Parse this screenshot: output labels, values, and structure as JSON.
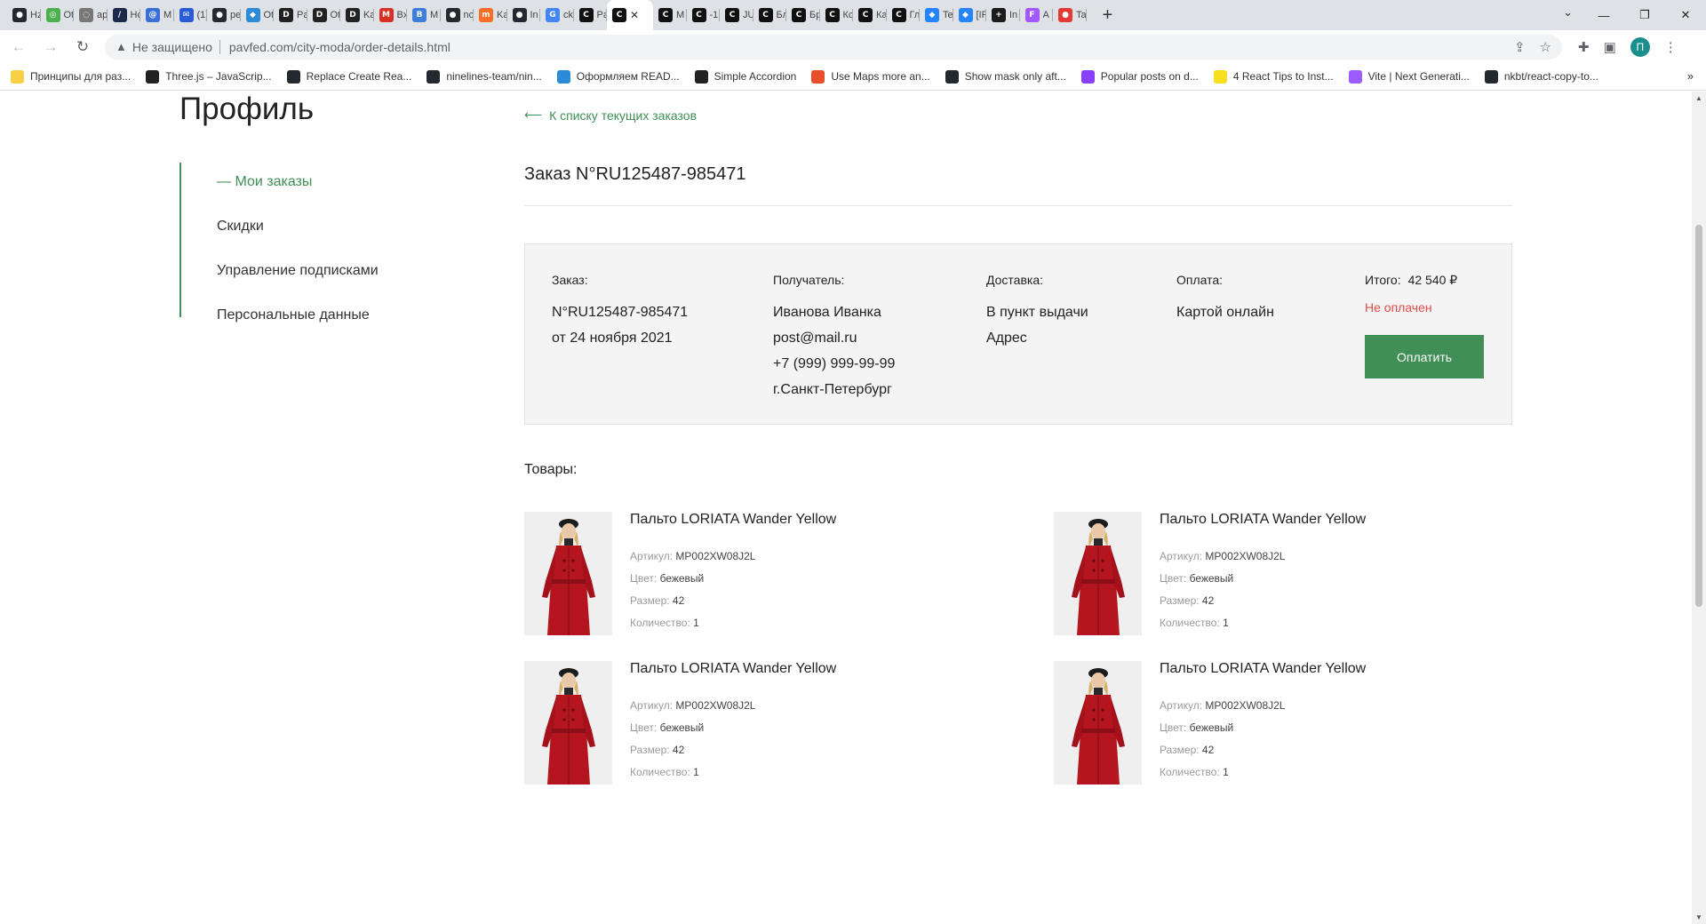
{
  "browser": {
    "tabs": [
      {
        "icon": "github-icon",
        "title": "Hz",
        "color": "#24292f",
        "glyph": "●"
      },
      {
        "icon": "circle-icon",
        "title": "Ot",
        "color": "#4caf50",
        "glyph": "◎"
      },
      {
        "icon": "globe-icon",
        "title": "ap",
        "color": "#777777",
        "glyph": "◌"
      },
      {
        "icon": "slash-icon",
        "title": "Hc",
        "color": "#1b2a4a",
        "glyph": "/"
      },
      {
        "icon": "at-icon",
        "title": "M",
        "color": "#3b6fd8",
        "glyph": "@"
      },
      {
        "icon": "mail-icon",
        "title": "(1)",
        "color": "#2a5bd7",
        "glyph": "✉"
      },
      {
        "icon": "github-icon",
        "title": "pe",
        "color": "#24292f",
        "glyph": "●"
      },
      {
        "icon": "puzzle-icon",
        "title": "Ot",
        "color": "#2b8bd6",
        "glyph": "◆"
      },
      {
        "icon": "deu-icon",
        "title": "Pa",
        "color": "#222222",
        "glyph": "D"
      },
      {
        "icon": "deu-icon",
        "title": "Ot",
        "color": "#222222",
        "glyph": "D"
      },
      {
        "icon": "deu-icon",
        "title": "Ka",
        "color": "#222222",
        "glyph": "D"
      },
      {
        "icon": "gmail-icon",
        "title": "Bx",
        "color": "#d93025",
        "glyph": "M"
      },
      {
        "icon": "box-icon",
        "title": "M",
        "color": "#3f7fd8",
        "glyph": "B"
      },
      {
        "icon": "github-icon",
        "title": "nc",
        "color": "#24292f",
        "glyph": "●"
      },
      {
        "icon": "gitlab-icon",
        "title": "Ka",
        "color": "#fc6d26",
        "glyph": "m"
      },
      {
        "icon": "github-icon",
        "title": "In",
        "color": "#24292f",
        "glyph": "●"
      },
      {
        "icon": "google-icon",
        "title": "ck",
        "color": "#4285f4",
        "glyph": "G"
      },
      {
        "icon": "codepen-icon",
        "title": "Pa",
        "color": "#111111",
        "glyph": "C"
      },
      {
        "icon": "codepen-icon",
        "title": "",
        "color": "#111111",
        "glyph": "C",
        "active": true
      },
      {
        "icon": "codepen-icon",
        "title": "M",
        "color": "#111111",
        "glyph": "C"
      },
      {
        "icon": "codepen-icon",
        "title": "-1",
        "color": "#111111",
        "glyph": "C"
      },
      {
        "icon": "codepen-icon",
        "title": "JU",
        "color": "#111111",
        "glyph": "C"
      },
      {
        "icon": "codepen-icon",
        "title": "Бл",
        "color": "#111111",
        "glyph": "C"
      },
      {
        "icon": "codepen-icon",
        "title": "Бр",
        "color": "#111111",
        "glyph": "C"
      },
      {
        "icon": "codepen-icon",
        "title": "Кс",
        "color": "#111111",
        "glyph": "C"
      },
      {
        "icon": "codepen-icon",
        "title": "Ка",
        "color": "#111111",
        "glyph": "C"
      },
      {
        "icon": "codepen-icon",
        "title": "Гл",
        "color": "#111111",
        "glyph": "C"
      },
      {
        "icon": "jira-icon",
        "title": "Te",
        "color": "#2684ff",
        "glyph": "◆"
      },
      {
        "icon": "jira-icon",
        "title": "[IF",
        "color": "#2684ff",
        "glyph": "◆"
      },
      {
        "icon": "plus-square-icon",
        "title": "In",
        "color": "#1b1b1b",
        "glyph": "+"
      },
      {
        "icon": "figma-icon",
        "title": "A",
        "color": "#a259ff",
        "glyph": "F"
      },
      {
        "icon": "chrome-red-icon",
        "title": "Ta",
        "color": "#e53935",
        "glyph": "●"
      }
    ],
    "active_tab_close": "✕",
    "new_tab": "+",
    "window_controls": {
      "minimize": "—",
      "restore": "❐",
      "close": "✕"
    },
    "tab_search": "⌄",
    "insecure_label": "Не защищено",
    "url": "pavfed.com/city-moda/order-details.html",
    "profile_initial": "П",
    "bookmarks": [
      {
        "icon": "bookmark-icon",
        "label": "Принципы для раз...",
        "color": "#f7d046"
      },
      {
        "icon": "threejs-icon",
        "label": "Three.js – JavaScrip...",
        "color": "#222222"
      },
      {
        "icon": "github-icon",
        "label": "Replace Create Rea...",
        "color": "#24292f"
      },
      {
        "icon": "github-icon",
        "label": "ninelines-team/nin...",
        "color": "#24292f"
      },
      {
        "icon": "puzzle-icon",
        "label": "Оформляем READ...",
        "color": "#2b8bd6"
      },
      {
        "icon": "accordion-icon",
        "label": "Simple Accordion",
        "color": "#222222"
      },
      {
        "icon": "maps-icon",
        "label": "Use Maps more an...",
        "color": "#e94e2a"
      },
      {
        "icon": "github-icon",
        "label": "Show mask only aft...",
        "color": "#24292f"
      },
      {
        "icon": "posts-icon",
        "label": "Popular posts on d...",
        "color": "#8a3ffc"
      },
      {
        "icon": "js-icon",
        "label": "4 React Tips to Inst...",
        "color": "#f7df1e"
      },
      {
        "icon": "vite-icon",
        "label": "Vite | Next Generati...",
        "color": "#9c5cff"
      },
      {
        "icon": "github-icon",
        "label": "nkbt/react-copy-to...",
        "color": "#24292f"
      }
    ],
    "bookmarks_more": "»"
  },
  "page": {
    "title": "Профиль",
    "side_nav": [
      {
        "label": "— Мои заказы",
        "active": true
      },
      {
        "label": "Скидки"
      },
      {
        "label": "Управление подписками"
      },
      {
        "label": "Персональные данные"
      }
    ],
    "back_link": "К списку текущих заказов",
    "order_title": "Заказ N°RU125487-985471",
    "summary": {
      "order": {
        "label": "Заказ:",
        "lines": [
          "N°RU125487-985471",
          "от 24 ноября 2021"
        ]
      },
      "recipient": {
        "label": "Получатель:",
        "lines": [
          "Иванова Иванка",
          "post@mail.ru",
          "+7 (999) 999-99-99",
          "г.Санкт-Петербург"
        ]
      },
      "delivery": {
        "label": "Доставка:",
        "lines": [
          "В пункт выдачи",
          "Адрес"
        ]
      },
      "payment": {
        "label": "Оплата:",
        "lines": [
          "Картой онлайн"
        ]
      },
      "total": {
        "label": "Итого:",
        "value": "42 540 ₽",
        "status": "Не оплачен",
        "status_color": "#e24b4b"
      },
      "pay_button": "Оплатить"
    },
    "goods_label": "Товары:",
    "attr_labels": {
      "sku": "Артикул:",
      "color": "Цвет:",
      "size": "Размер:",
      "qty": "Количество:"
    },
    "products": [
      {
        "name": "Пальто LORIATA Wander Yellow",
        "sku": "MP002XW08J2L",
        "color": "бежевый",
        "size": "42",
        "qty": "1"
      },
      {
        "name": "Пальто LORIATA Wander Yellow",
        "sku": "MP002XW08J2L",
        "color": "бежевый",
        "size": "42",
        "qty": "1"
      },
      {
        "name": "Пальто LORIATA Wander Yellow",
        "sku": "MP002XW08J2L",
        "color": "бежевый",
        "size": "42",
        "qty": "1"
      },
      {
        "name": "Пальто LORIATA Wander Yellow",
        "sku": "MP002XW08J2L",
        "color": "бежевый",
        "size": "42",
        "qty": "1"
      }
    ],
    "accent_color": "#3f8f56"
  }
}
